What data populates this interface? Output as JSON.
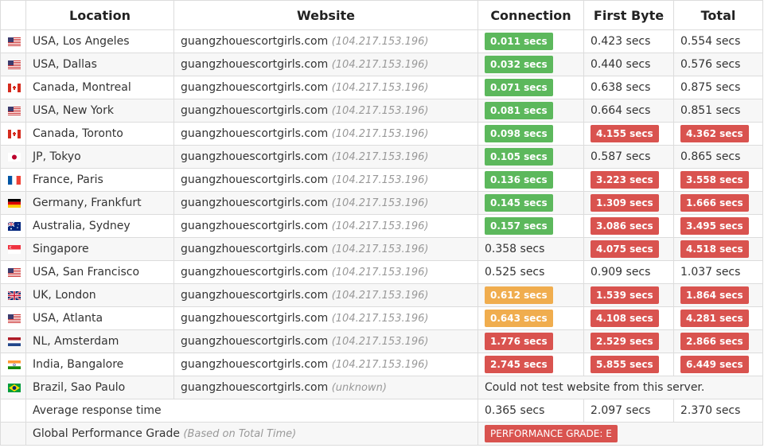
{
  "headers": {
    "location": "Location",
    "website": "Website",
    "connection": "Connection",
    "first_byte": "First Byte",
    "total": "Total"
  },
  "colors": {
    "green": "#5cb85c",
    "red": "#d9534f",
    "orange": "#f0ad4e"
  },
  "rows": [
    {
      "flag": "us-flag",
      "location": "USA, Los Angeles",
      "site": "guangzhouescortgirls.com",
      "ip": "(104.217.153.196)",
      "conn": "0.011 secs",
      "conn_c": "green",
      "fb": "0.423 secs",
      "fb_c": "",
      "total": "0.554 secs",
      "total_c": ""
    },
    {
      "flag": "us-flag",
      "location": "USA, Dallas",
      "site": "guangzhouescortgirls.com",
      "ip": "(104.217.153.196)",
      "conn": "0.032 secs",
      "conn_c": "green",
      "fb": "0.440 secs",
      "fb_c": "",
      "total": "0.576 secs",
      "total_c": ""
    },
    {
      "flag": "ca-flag",
      "location": "Canada, Montreal",
      "site": "guangzhouescortgirls.com",
      "ip": "(104.217.153.196)",
      "conn": "0.071 secs",
      "conn_c": "green",
      "fb": "0.638 secs",
      "fb_c": "",
      "total": "0.875 secs",
      "total_c": ""
    },
    {
      "flag": "us-flag",
      "location": "USA, New York",
      "site": "guangzhouescortgirls.com",
      "ip": "(104.217.153.196)",
      "conn": "0.081 secs",
      "conn_c": "green",
      "fb": "0.664 secs",
      "fb_c": "",
      "total": "0.851 secs",
      "total_c": ""
    },
    {
      "flag": "ca-flag",
      "location": "Canada, Toronto",
      "site": "guangzhouescortgirls.com",
      "ip": "(104.217.153.196)",
      "conn": "0.098 secs",
      "conn_c": "green",
      "fb": "4.155 secs",
      "fb_c": "red",
      "total": "4.362 secs",
      "total_c": "red"
    },
    {
      "flag": "jp-flag",
      "location": "JP, Tokyo",
      "site": "guangzhouescortgirls.com",
      "ip": "(104.217.153.196)",
      "conn": "0.105 secs",
      "conn_c": "green",
      "fb": "0.587 secs",
      "fb_c": "",
      "total": "0.865 secs",
      "total_c": ""
    },
    {
      "flag": "fr-flag",
      "location": "France, Paris",
      "site": "guangzhouescortgirls.com",
      "ip": "(104.217.153.196)",
      "conn": "0.136 secs",
      "conn_c": "green",
      "fb": "3.223 secs",
      "fb_c": "red",
      "total": "3.558 secs",
      "total_c": "red"
    },
    {
      "flag": "de-flag",
      "location": "Germany, Frankfurt",
      "site": "guangzhouescortgirls.com",
      "ip": "(104.217.153.196)",
      "conn": "0.145 secs",
      "conn_c": "green",
      "fb": "1.309 secs",
      "fb_c": "red",
      "total": "1.666 secs",
      "total_c": "red"
    },
    {
      "flag": "au-flag",
      "location": "Australia, Sydney",
      "site": "guangzhouescortgirls.com",
      "ip": "(104.217.153.196)",
      "conn": "0.157 secs",
      "conn_c": "green",
      "fb": "3.086 secs",
      "fb_c": "red",
      "total": "3.495 secs",
      "total_c": "red"
    },
    {
      "flag": "sg-flag",
      "location": "Singapore",
      "site": "guangzhouescortgirls.com",
      "ip": "(104.217.153.196)",
      "conn": "0.358 secs",
      "conn_c": "",
      "fb": "4.075 secs",
      "fb_c": "red",
      "total": "4.518 secs",
      "total_c": "red"
    },
    {
      "flag": "us-flag",
      "location": "USA, San Francisco",
      "site": "guangzhouescortgirls.com",
      "ip": "(104.217.153.196)",
      "conn": "0.525 secs",
      "conn_c": "",
      "fb": "0.909 secs",
      "fb_c": "",
      "total": "1.037 secs",
      "total_c": ""
    },
    {
      "flag": "uk-flag",
      "location": "UK, London",
      "site": "guangzhouescortgirls.com",
      "ip": "(104.217.153.196)",
      "conn": "0.612 secs",
      "conn_c": "orange",
      "fb": "1.539 secs",
      "fb_c": "red",
      "total": "1.864 secs",
      "total_c": "red"
    },
    {
      "flag": "us-flag",
      "location": "USA, Atlanta",
      "site": "guangzhouescortgirls.com",
      "ip": "(104.217.153.196)",
      "conn": "0.643 secs",
      "conn_c": "orange",
      "fb": "4.108 secs",
      "fb_c": "red",
      "total": "4.281 secs",
      "total_c": "red"
    },
    {
      "flag": "nl-flag",
      "location": "NL, Amsterdam",
      "site": "guangzhouescortgirls.com",
      "ip": "(104.217.153.196)",
      "conn": "1.776 secs",
      "conn_c": "red",
      "fb": "2.529 secs",
      "fb_c": "red",
      "total": "2.866 secs",
      "total_c": "red"
    },
    {
      "flag": "in-flag",
      "location": "India, Bangalore",
      "site": "guangzhouescortgirls.com",
      "ip": "(104.217.153.196)",
      "conn": "2.745 secs",
      "conn_c": "red",
      "fb": "5.855 secs",
      "fb_c": "red",
      "total": "6.449 secs",
      "total_c": "red"
    }
  ],
  "brazil": {
    "flag": "br-flag",
    "location": "Brazil, Sao Paulo",
    "site": "guangzhouescortgirls.com",
    "ip": "(unknown)",
    "message": "Could not test website from this server."
  },
  "average": {
    "label": "Average response time",
    "conn": "0.365 secs",
    "fb": "2.097 secs",
    "total": "2.370 secs"
  },
  "grade": {
    "label": "Global Performance Grade",
    "note": "(Based on Total Time)",
    "badge": "PERFORMANCE GRADE: E"
  }
}
